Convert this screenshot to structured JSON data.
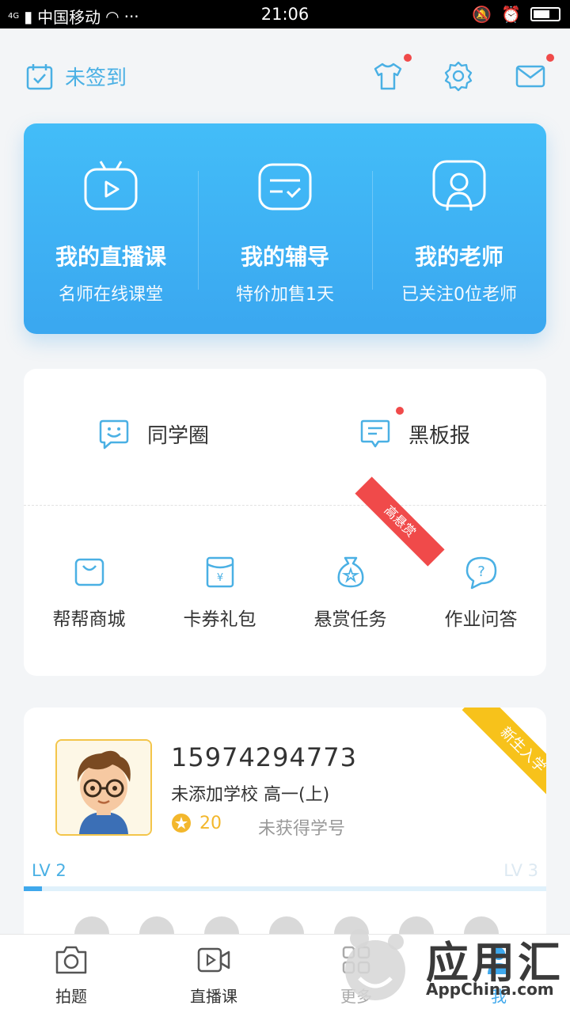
{
  "status_bar": {
    "network": "4G",
    "carrier": "中国移动",
    "dots": "···",
    "time": "21:06"
  },
  "header": {
    "checkin_label": "未签到"
  },
  "live_card": {
    "items": [
      {
        "title": "我的直播课",
        "subtitle": "名师在线课堂"
      },
      {
        "title": "我的辅导",
        "subtitle": "特价加售1天"
      },
      {
        "title": "我的老师",
        "subtitle": "已关注0位老师"
      }
    ]
  },
  "community": {
    "items": [
      {
        "label": "同学圈"
      },
      {
        "label": "黑板报"
      }
    ]
  },
  "services": {
    "items": [
      {
        "label": "帮帮商城"
      },
      {
        "label": "卡券礼包"
      },
      {
        "label": "悬赏任务"
      },
      {
        "label": "作业问答"
      }
    ],
    "ribbon": "高悬赏"
  },
  "profile": {
    "phone": "15974294773",
    "school": "未添加学校 高一(上)",
    "coins": "20",
    "student_id": "未获得学号",
    "newbie_ribbon": "新生入学",
    "level_current": "LV 2",
    "level_next": "LV 3",
    "level_progress": 0.035
  },
  "bottom_nav": {
    "tabs": [
      {
        "label": "拍题"
      },
      {
        "label": "直播课"
      },
      {
        "label": "更多"
      },
      {
        "label": "我"
      }
    ]
  },
  "watermark": {
    "brand": "应用汇",
    "domain": "AppChina.com"
  },
  "colors": {
    "accent": "#3fa8ec",
    "badge_red": "#f04a4a",
    "gold": "#f3b72c"
  }
}
